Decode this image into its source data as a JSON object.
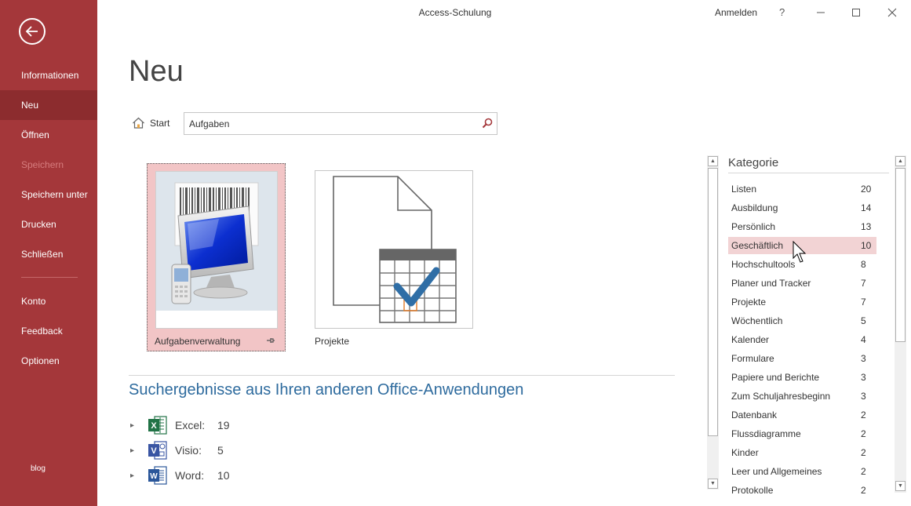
{
  "window": {
    "title": "Access-Schulung",
    "signin": "Anmelden",
    "help": "?"
  },
  "sidebar": {
    "items": [
      {
        "label": "Informationen"
      },
      {
        "label": "Neu"
      },
      {
        "label": "Öffnen"
      },
      {
        "label": "Speichern"
      },
      {
        "label": "Speichern unter"
      },
      {
        "label": "Drucken"
      },
      {
        "label": "Schließen"
      },
      {
        "label": "Konto"
      },
      {
        "label": "Feedback"
      },
      {
        "label": "Optionen"
      }
    ],
    "blog": "blog"
  },
  "main": {
    "heading": "Neu",
    "start_label": "Start",
    "search_value": "Aufgaben",
    "templates": [
      {
        "label": "Aufgabenverwaltung"
      },
      {
        "label": "Projekte"
      }
    ],
    "other_results_heading": "Suchergebnisse aus Ihren anderen Office-Anwendungen",
    "apps": [
      {
        "name": "Excel:",
        "count": "19",
        "color": "#217346"
      },
      {
        "name": "Visio:",
        "count": "5",
        "color": "#3955a3"
      },
      {
        "name": "Word:",
        "count": "10",
        "color": "#2b579a"
      }
    ]
  },
  "category": {
    "title": "Kategorie",
    "items": [
      {
        "name": "Listen",
        "count": "20"
      },
      {
        "name": "Ausbildung",
        "count": "14"
      },
      {
        "name": "Persönlich",
        "count": "13"
      },
      {
        "name": "Geschäftlich",
        "count": "10"
      },
      {
        "name": "Hochschultools",
        "count": "8"
      },
      {
        "name": "Planer und Tracker",
        "count": "7"
      },
      {
        "name": "Projekte",
        "count": "7"
      },
      {
        "name": "Wöchentlich",
        "count": "5"
      },
      {
        "name": "Kalender",
        "count": "4"
      },
      {
        "name": "Formulare",
        "count": "3"
      },
      {
        "name": "Papiere und Berichte",
        "count": "3"
      },
      {
        "name": "Zum Schuljahresbeginn",
        "count": "3"
      },
      {
        "name": "Datenbank",
        "count": "2"
      },
      {
        "name": "Flussdiagramme",
        "count": "2"
      },
      {
        "name": "Kinder",
        "count": "2"
      },
      {
        "name": "Leer und Allgemeines",
        "count": "2"
      },
      {
        "name": "Protokolle",
        "count": "2"
      }
    ]
  },
  "colors": {
    "sidebar": "#a4373a",
    "sidebar_active": "#8c2c2e",
    "accent_blue": "#2e6b9e",
    "category_highlight": "#f2d3d4"
  }
}
